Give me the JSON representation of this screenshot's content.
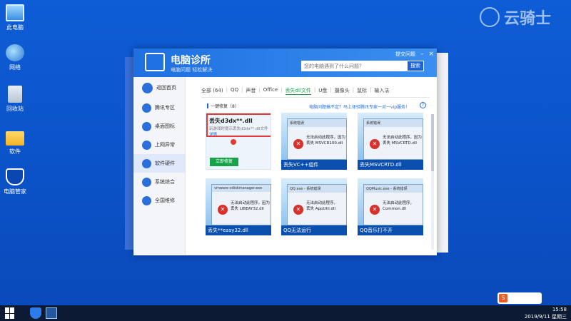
{
  "desktop": {
    "icons": [
      {
        "label": "此电脑",
        "icon": "computer-icon"
      },
      {
        "label": "网络",
        "icon": "network-icon"
      },
      {
        "label": "回收站",
        "icon": "recycle-bin-icon"
      },
      {
        "label": "软件",
        "icon": "folder-icon"
      },
      {
        "label": "电脑管家",
        "icon": "shield-icon"
      }
    ],
    "watermark": "云骑士"
  },
  "window": {
    "title": "电脑诊所",
    "subtitle": "电脑问题  轻松解决",
    "feedback_link": "提交问题",
    "search": {
      "placeholder": "您的电脑遇到了什么问题？",
      "button": "搜索"
    }
  },
  "sidebar": {
    "back_label": "返回首页",
    "items": [
      {
        "label": "腾讯专区"
      },
      {
        "label": "桌面图标"
      },
      {
        "label": "上网异常"
      },
      {
        "label": "软件硬件"
      },
      {
        "label": "系统综合"
      },
      {
        "label": "全国维修"
      }
    ]
  },
  "categories": [
    "全部 (64)",
    "QQ",
    "声音",
    "Office",
    "丢失dll文件",
    "U盘",
    "摄像头",
    "鼠标",
    "输入法"
  ],
  "active_category": "丢失dll文件",
  "section": {
    "label": "一键修复（8）",
    "help_text": "电脑问题搞不定？马上体验腾讯专家一对一vip服务！",
    "help_icon": "?"
  },
  "cards": [
    {
      "title": "丢失d3dx**.dll",
      "desc": "玩游戏时提示丢失d3dx**.dll文件",
      "link": "详情",
      "button": "立即修复"
    },
    {
      "caption": "丢失VC++组件",
      "dialog_title": "系统错误",
      "msg1": "无法启动此程序，因为",
      "msg2": "丢失 MSVCR100.dll"
    },
    {
      "caption": "丢失MSVCRTD.dll",
      "dialog_title": "系统错误",
      "msg1": "无法启动此程序，因为",
      "msg2": "丢失 MSVCRTD.dll"
    },
    {
      "caption": "丢失**easy32.dll",
      "dialog_title": "vmware-vdiskmanager.exe",
      "msg1": "无法启动此程序，因为",
      "msg2": "丢失 LIBEAY32.dll"
    },
    {
      "caption": "QQ无法运行",
      "dialog_title": "QQ.exe - 系统错误",
      "msg1": "无法启动此程序，",
      "msg2": "丢失 AppUtil.dll"
    },
    {
      "caption": "QQ音乐打不开",
      "dialog_title": "QQMusic.exe - 系统错误",
      "msg1": "无法启动此程序，",
      "msg2": "Common.dll"
    }
  ],
  "taskbar": {
    "time": "15:58",
    "date": "2019/9/11 星期三",
    "lang": "中"
  }
}
